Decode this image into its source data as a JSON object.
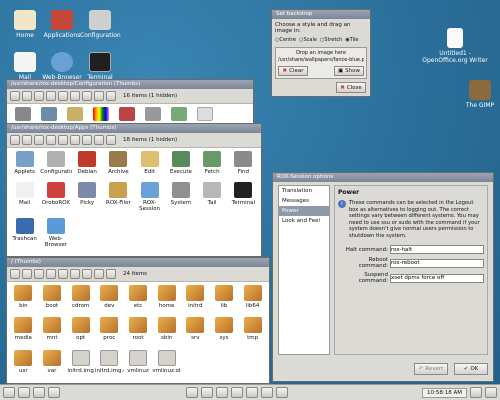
{
  "desktop": {
    "icons": [
      {
        "label": "Home",
        "icon": "home-icon",
        "color": "#f0e6c8"
      },
      {
        "label": "Applications",
        "icon": "applications-icon",
        "color": "#c7473a"
      },
      {
        "label": "Configuration",
        "icon": "tools-icon",
        "color": "#cfcfcf"
      },
      {
        "label": "Mail",
        "icon": "mail-icon",
        "color": "#f5f5f5"
      },
      {
        "label": "Web-Browser",
        "icon": "globe-icon",
        "color": "#6aa0d8"
      },
      {
        "label": "Terminal",
        "icon": "terminal-icon",
        "color": "#202020"
      },
      {
        "label": "Untitled1 - OpenOffice.org Writer",
        "icon": "document-icon",
        "color": "#fafafa"
      },
      {
        "label": "The GIMP",
        "icon": "gimp-icon",
        "color": "#8b6a3e"
      }
    ]
  },
  "backdrop": {
    "title": "Set backdrop",
    "prompt": "Choose a style and drag an image in:",
    "styles": [
      "Centre",
      "Scale",
      "Stretch",
      "Tile"
    ],
    "selected_style": "Tile",
    "drop_label": "Drop an image here",
    "path": "/usr/share/wallpapers/fance-blue.png",
    "clear": "Clear",
    "show": "Show",
    "close": "Close"
  },
  "win1": {
    "title": "/usr/share/rox-desktop/Configuration (Thumbs)",
    "count": "16 items (1 hidden)"
  },
  "win2": {
    "title": "/usr/share/rox-desktop/Apps (Thumbs)",
    "count": "18 items (1 hidden)",
    "items": [
      "Applets",
      "Configuration",
      "Debian",
      "Archive",
      "Edit",
      "Execute",
      "Fetch",
      "Find",
      "Mail",
      "OroboROX",
      "Picky",
      "ROX-Filer",
      "ROX-Session",
      "System",
      "Tail",
      "Terminal",
      "Trashcan",
      "Web-Browser"
    ]
  },
  "win3": {
    "title": "/ (Thumbs)",
    "count": "24 items",
    "items": [
      "bin",
      "boot",
      "cdrom",
      "dev",
      "etc",
      "home",
      "initrd",
      "lib",
      "lib64",
      "media",
      "mnt",
      "opt",
      "proc",
      "root",
      "sbin",
      "srv",
      "sys",
      "tmp",
      "usr",
      "var",
      "initrd.img",
      "initrd.img.old",
      "vmlinuz",
      "vmlinuz.old"
    ]
  },
  "session": {
    "title": "ROX-Session options",
    "sections": [
      "Translation",
      "Messages",
      "Power",
      "Look and Feel"
    ],
    "selected": "Power",
    "heading": "Power",
    "description": "These commands can be selected in the Logout box as alternatives to logging out. The correct settings vary between different systems. You may need to use ssu or sudo with the command if your system doesn't give normal users permission to shutdown the system.",
    "halt_label": "Halt command:",
    "halt_value": "rox-halt",
    "reboot_label": "Reboot command:",
    "reboot_value": "rox-reboot",
    "suspend_label": "Suspend command:",
    "suspend_value": "xset dpms force off",
    "revert": "Revert",
    "ok": "OK"
  },
  "taskbar": {
    "clock": "10:58:18 AM"
  }
}
